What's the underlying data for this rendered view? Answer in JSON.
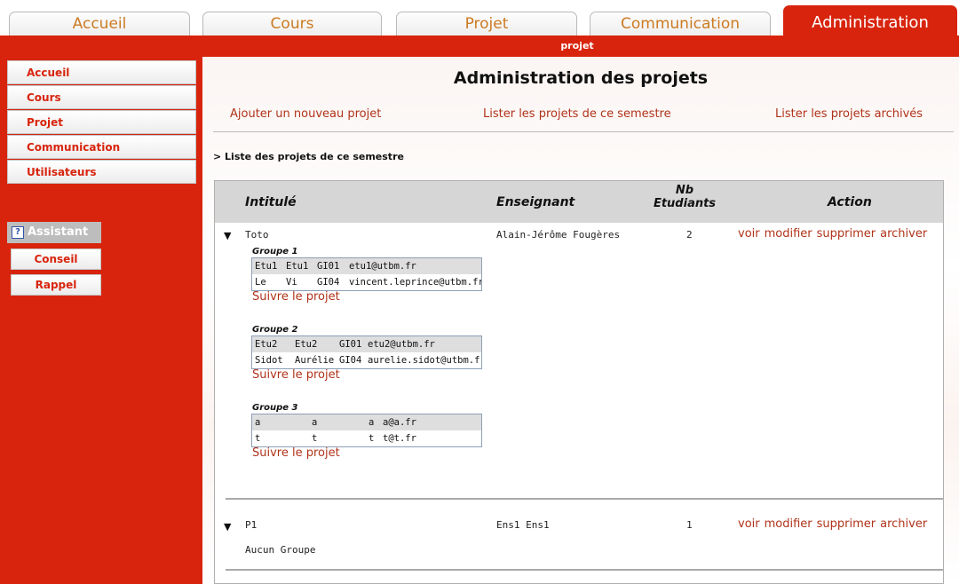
{
  "tabs": [
    {
      "label": "Accueil"
    },
    {
      "label": "Cours"
    },
    {
      "label": "Projet"
    },
    {
      "label": "Communication"
    },
    {
      "label": "Administration"
    }
  ],
  "section_label": "projet",
  "sidebar": {
    "items": [
      {
        "label": "Accueil"
      },
      {
        "label": "Cours"
      },
      {
        "label": "Projet"
      },
      {
        "label": "Communication"
      },
      {
        "label": "Utilisateurs"
      }
    ],
    "assistant_label": "Assistant",
    "buttons": [
      {
        "label": "Conseil"
      },
      {
        "label": "Rappel"
      }
    ]
  },
  "main": {
    "title": "Administration des projets",
    "links": {
      "add": "Ajouter un nouveau projet",
      "list_current": "Lister les projets de ce semestre",
      "list_archived": "Lister les projets archivés"
    },
    "breadcrumb": "> Liste des projets de ce semestre",
    "table": {
      "headers": {
        "title": "Intitulé",
        "teacher": "Enseignant",
        "students_line1": "Nb",
        "students_line2": "Etudiants",
        "action": "Action"
      },
      "actions": {
        "view": "voir",
        "edit": "modifier",
        "delete": "supprimer",
        "archive": "archiver"
      },
      "projects": [
        {
          "name": "Toto",
          "teacher": "Alain-Jérôme Fougères",
          "students": "2",
          "groups": [
            {
              "title": "Groupe 1",
              "members": [
                {
                  "lastname": "Etu1",
                  "firstname": "Etu1",
                  "branch": "GI01",
                  "email": "etu1@utbm.fr"
                },
                {
                  "lastname": "Le",
                  "firstname": "Vi",
                  "branch": "GI04",
                  "email": "vincent.leprince@utbm.fr"
                }
              ]
            },
            {
              "title": "Groupe 2",
              "members": [
                {
                  "lastname": "Etu2",
                  "firstname": "Etu2",
                  "branch": "GI01",
                  "email": "etu2@utbm.fr"
                },
                {
                  "lastname": "Sidot",
                  "firstname": "Aurélie",
                  "branch": "GI04",
                  "email": "aurelie.sidot@utbm.fr"
                }
              ]
            },
            {
              "title": "Groupe 3",
              "members": [
                {
                  "lastname": "a",
                  "firstname": "a",
                  "branch": "a",
                  "email": "a@a.fr"
                },
                {
                  "lastname": "t",
                  "firstname": "t",
                  "branch": "t",
                  "email": "t@t.fr"
                }
              ]
            }
          ],
          "follow_label": "Suivre le projet"
        },
        {
          "name": "P1",
          "teacher": "Ens1 Ens1",
          "students": "1",
          "no_group": "Aucun Groupe"
        }
      ]
    }
  },
  "icons": {
    "expand": "triangle-down-icon",
    "help": "question-mark-icon"
  },
  "colors": {
    "brand_red": "#d8240d",
    "link": "#b0331a",
    "tab_text": "#cc7a22"
  }
}
